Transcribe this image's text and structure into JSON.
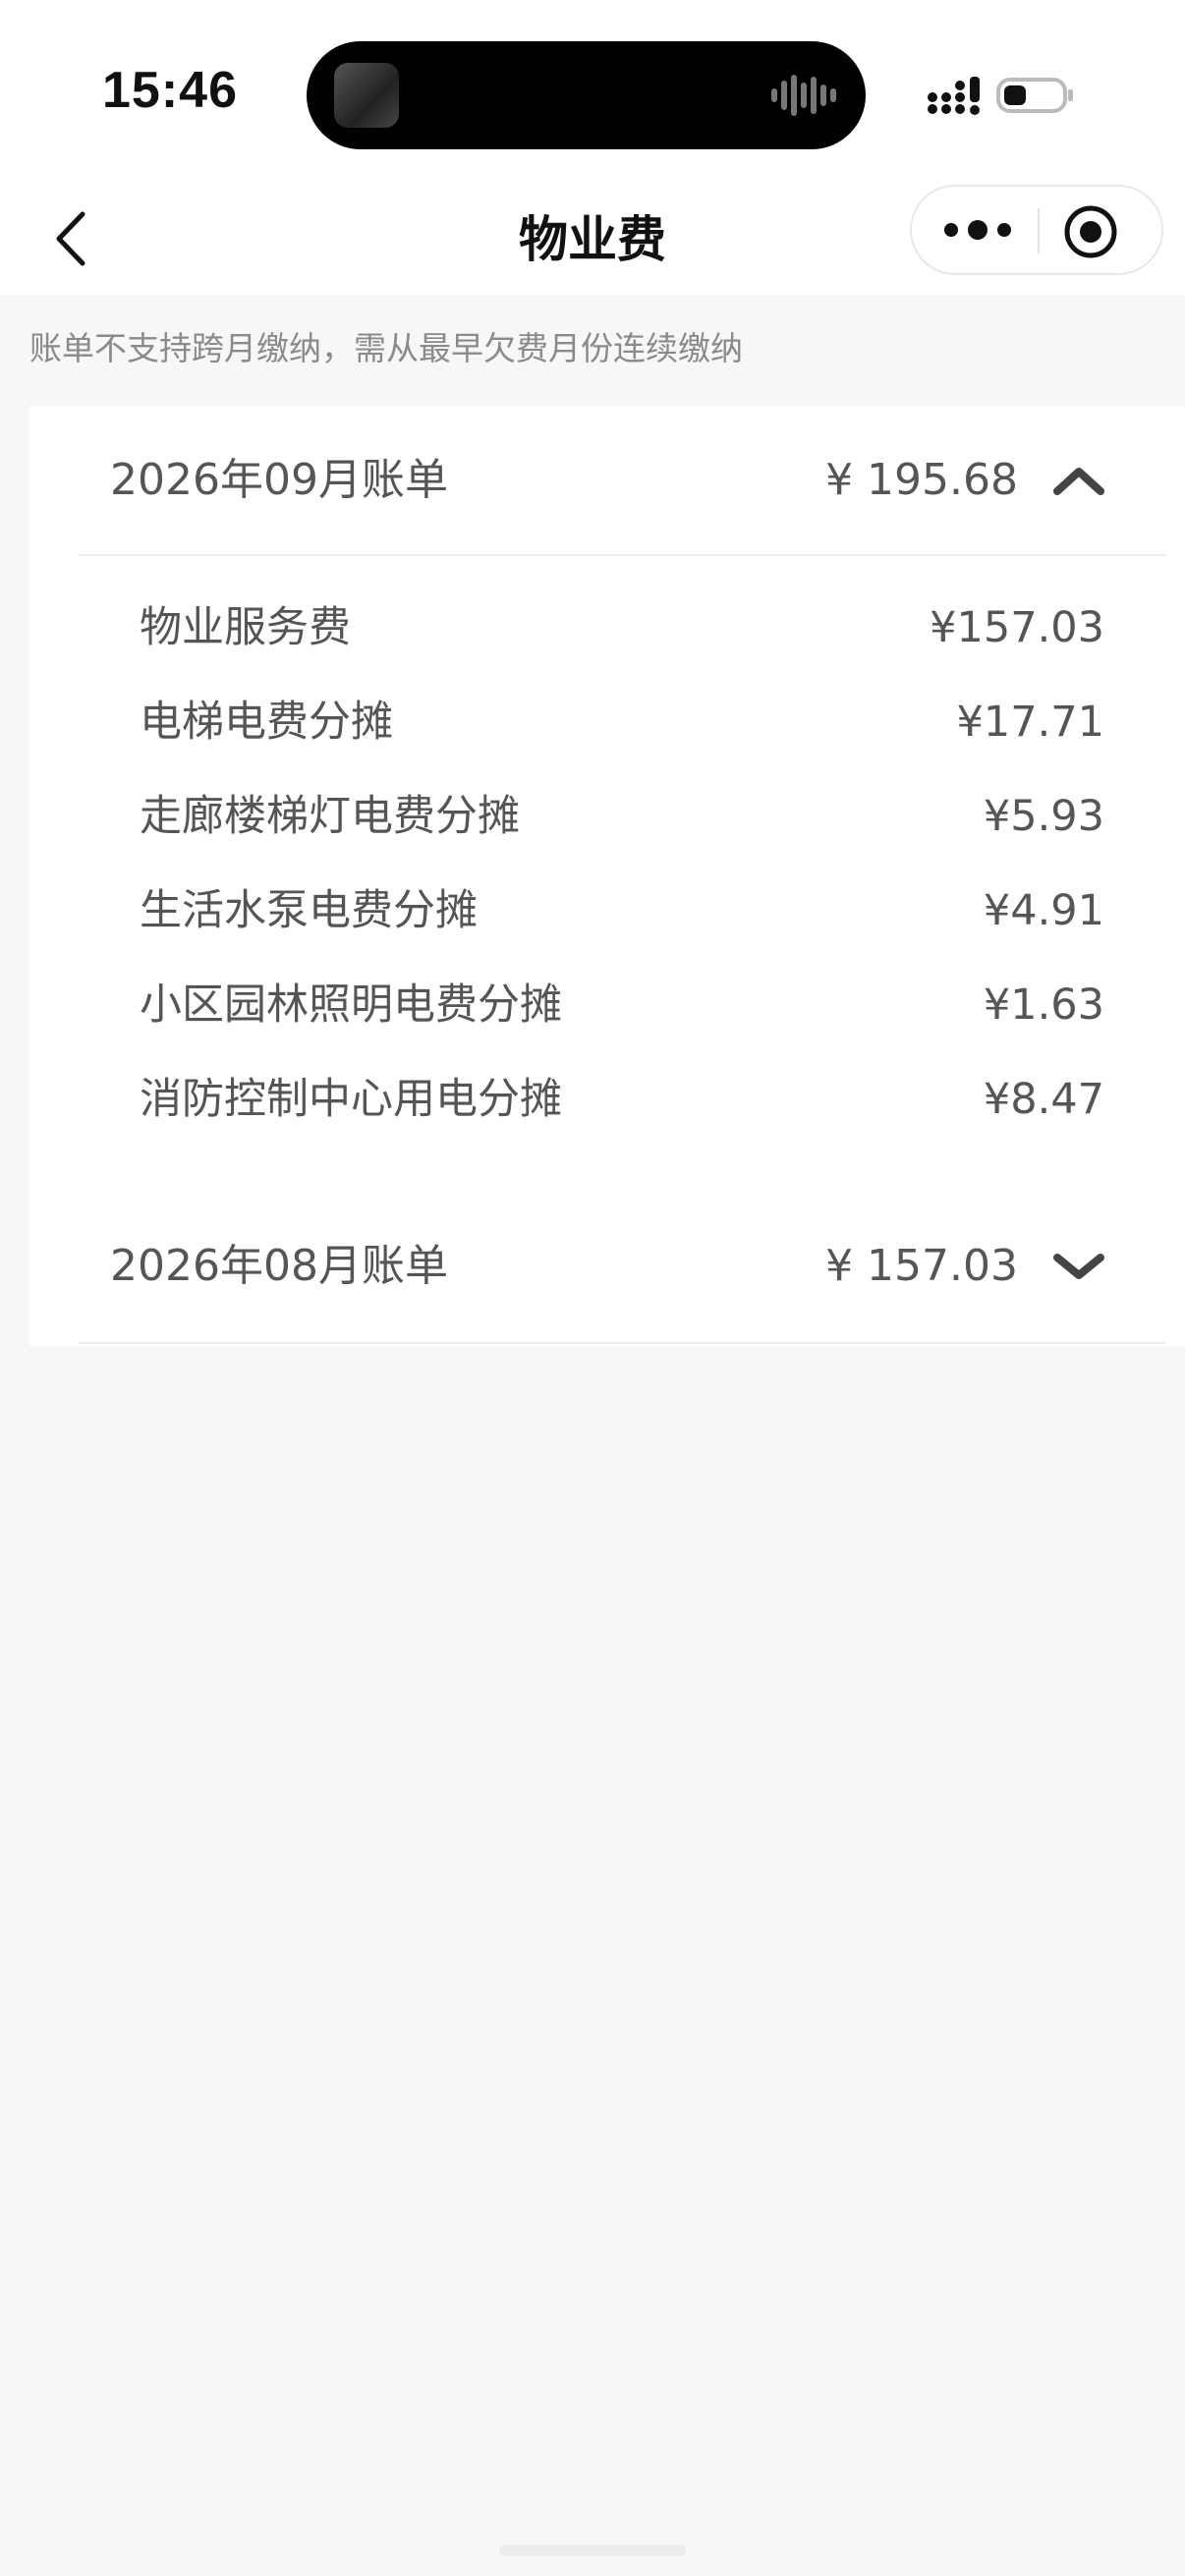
{
  "status_bar": {
    "time": "15:46",
    "icons": [
      "camera-avatar-icon",
      "audio-wave-icon",
      "signal-icon",
      "battery-icon"
    ]
  },
  "nav": {
    "title": "物业费",
    "back_icon": "chevron-left-icon",
    "more_icon": "more-dots-icon",
    "close_icon": "target-close-icon"
  },
  "notice": "账单不支持跨月缴纳，需从最早欠费月份连续缴纳",
  "bills": [
    {
      "title": "2026年09月账单",
      "amount": "¥ 195.68",
      "expanded": true,
      "items": [
        {
          "label": "物业服务费",
          "value": "¥157.03"
        },
        {
          "label": "电梯电费分摊",
          "value": "¥17.71"
        },
        {
          "label": "走廊楼梯灯电费分摊",
          "value": "¥5.93"
        },
        {
          "label": "生活水泵电费分摊",
          "value": "¥4.91"
        },
        {
          "label": "小区园林照明电费分摊",
          "value": "¥1.63"
        },
        {
          "label": "消防控制中心用电分摊",
          "value": "¥8.47"
        }
      ]
    },
    {
      "title": "2026年08月账单",
      "amount": "¥ 157.03",
      "expanded": false,
      "items": []
    }
  ],
  "colors": {
    "page_bg": "#f7f7f7",
    "card_bg": "#ffffff",
    "text_primary": "#111111",
    "text_secondary": "#555555",
    "text_muted": "#8a8a8a"
  }
}
